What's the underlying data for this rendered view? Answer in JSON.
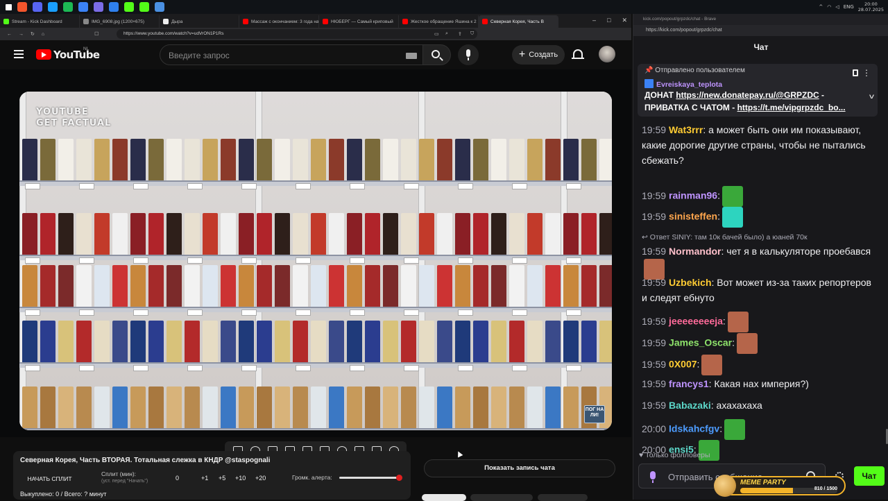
{
  "taskbar": {
    "time": "20:00",
    "date": "28.07.2025",
    "lang": "ENG",
    "icon_colors": [
      "#f2552c",
      "#5865f2",
      "#1a9fff",
      "#1db954",
      "#3b82f6",
      "#7b6ce6",
      "#2f80ed",
      "#53fc18",
      "#53fc18",
      "#4a90e2"
    ]
  },
  "browser": {
    "tabs": [
      {
        "label": "Stream - Kick Dashboard",
        "color": "#53fc18"
      },
      {
        "label": "IMG_6908.jpg (1200×675)",
        "color": "#888888"
      },
      {
        "label": "Дыра",
        "color": "#eeeeee"
      },
      {
        "label": "Массаж с окончанием: 3 года на",
        "color": "#ff0000"
      },
      {
        "label": "НЮБЕРГ — Самый криповый",
        "color": "#ff0000"
      },
      {
        "label": "Жесткое обращение Яшина к 2",
        "color": "#ff0000"
      },
      {
        "label": "Северная Корея, Часть В",
        "color": "#ff0000",
        "active": true
      }
    ],
    "url": "https://www.youtube.com/watch?v=udVrON1P1Rs"
  },
  "youtube": {
    "logo_text": "YouTube",
    "region": "NL",
    "search_placeholder": "Введите запрос",
    "create_label": "Создать"
  },
  "video": {
    "watermark_line1": "YOUTUBE",
    "watermark_line2": "GET FACTUAL",
    "corner_logo": "ПОГ НА ЛИ!"
  },
  "split": {
    "title": "Северная Корея, Часть ВТОРАЯ. Тотальная слежка в КНДР @staspognali",
    "start_label": "НАЧАТЬ СПЛИТ",
    "split_label": "Сплит (мин):",
    "split_hint": "(уст. перед \"Начать\")",
    "split_value": "0",
    "increments": [
      "+1",
      "+5",
      "+10",
      "+20"
    ],
    "volume_label": "Громк. алерта:",
    "volume_level": 0.95,
    "stats": "Выкуплено: 0 / Всего: ? минут"
  },
  "show_chat_label": "Показать запись чата",
  "chat_window": {
    "title": "kick.com/popout/grpzdc/chat - Brave",
    "url": "https://kick.com/popout/grpzdc/chat",
    "header": "Чат",
    "pinned": {
      "by": "Отправлено пользователем",
      "user": "Evreiskaya_teplota",
      "line1_prefix": "ДОНАТ ",
      "line1_link": "https://new.donatepay.ru/@GRPZDC",
      "line1_suffix": " -",
      "line2_prefix": "ПРИВАТКА С ЧАТОМ - ",
      "line2_link": "https://t.me/vipgrpzdc_bo..."
    },
    "messages": [
      {
        "ts": "19:59",
        "user": "Wat3rrr",
        "color": "#ffcc33",
        "text": " а может быть они им показывают, какие дорогие другие страны, чтобы не пытались сбежать?",
        "emote": ""
      },
      {
        "ts": "19:59",
        "user": "rainman96",
        "color": "#bf94ff",
        "text": "",
        "emote": "#3aa83a"
      },
      {
        "ts": "19:59",
        "user": "sinisteffen",
        "color": "#ffa64d",
        "text": "",
        "emote": "#2dd4bf"
      },
      {
        "ts": "19:59",
        "user": "Normandor",
        "color": "#ffc0cb",
        "text": " чет я в калькуляторе проебався",
        "emote": "#b5654a"
      },
      {
        "ts": "19:59",
        "user": "Uzbekich",
        "color": "#ffcc33",
        "text": " Вот может из-за таких репортеров и следят ебнуто",
        "emote": ""
      },
      {
        "ts": "19:59",
        "user": "jeeeeeeeeja",
        "color": "#ff6b9a",
        "text": "",
        "emote": "#b5654a"
      },
      {
        "ts": "19:59",
        "user": "James_Oscar",
        "color": "#8ee36b",
        "text": "",
        "emote": "#b5654a"
      },
      {
        "ts": "19:59",
        "user": "0X007",
        "color": "#ffcc33",
        "text": "",
        "emote": "#b5654a"
      },
      {
        "ts": "19:59",
        "user": "francys1",
        "color": "#bf94ff",
        "text": " Какая нах империя?)",
        "emote": ""
      },
      {
        "ts": "19:59",
        "user": "Babazaki",
        "color": "#5cd6c8",
        "text": " ахахахаха",
        "emote": ""
      },
      {
        "ts": "20:00",
        "user": "Idskahcfgv",
        "color": "#4d9cff",
        "text": "",
        "emote": "#3aa83a"
      },
      {
        "ts": "20:00",
        "user": "ensi5",
        "color": "#5cd6c8",
        "text": "",
        "emote": "#3aa83a"
      }
    ],
    "reply_to": "Ответ SINIY: там 10к бачей было) а юаней 70к",
    "followers_only": "Только фолловеры",
    "input_placeholder": "Отправить сообщение",
    "send_label": "Чат",
    "meme_party": {
      "title": "MEME PARTY",
      "count": "810 / 1500",
      "progress": 0.54
    }
  }
}
